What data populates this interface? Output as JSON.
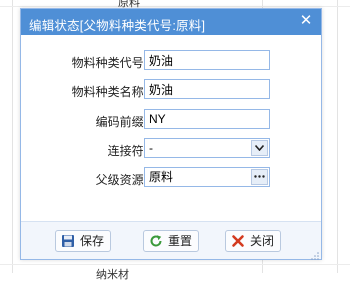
{
  "background": {
    "top_text": "原料",
    "bottom_text": "纳米材"
  },
  "dialog": {
    "title": "编辑状态[父物料种类代号:原料]",
    "close_glyph": "✕",
    "fields": {
      "code": {
        "label": "物料种类代号:",
        "value": "奶油"
      },
      "name": {
        "label": "物料种类名称:",
        "value": "奶油"
      },
      "prefix": {
        "label": "编码前缀:",
        "value": "NY"
      },
      "connector": {
        "label": "连接符:",
        "value": "-"
      },
      "parent": {
        "label": "父级资源:",
        "value": "原料"
      }
    },
    "buttons": {
      "save": "保存",
      "reset": "重置",
      "close": "关闭"
    }
  }
}
